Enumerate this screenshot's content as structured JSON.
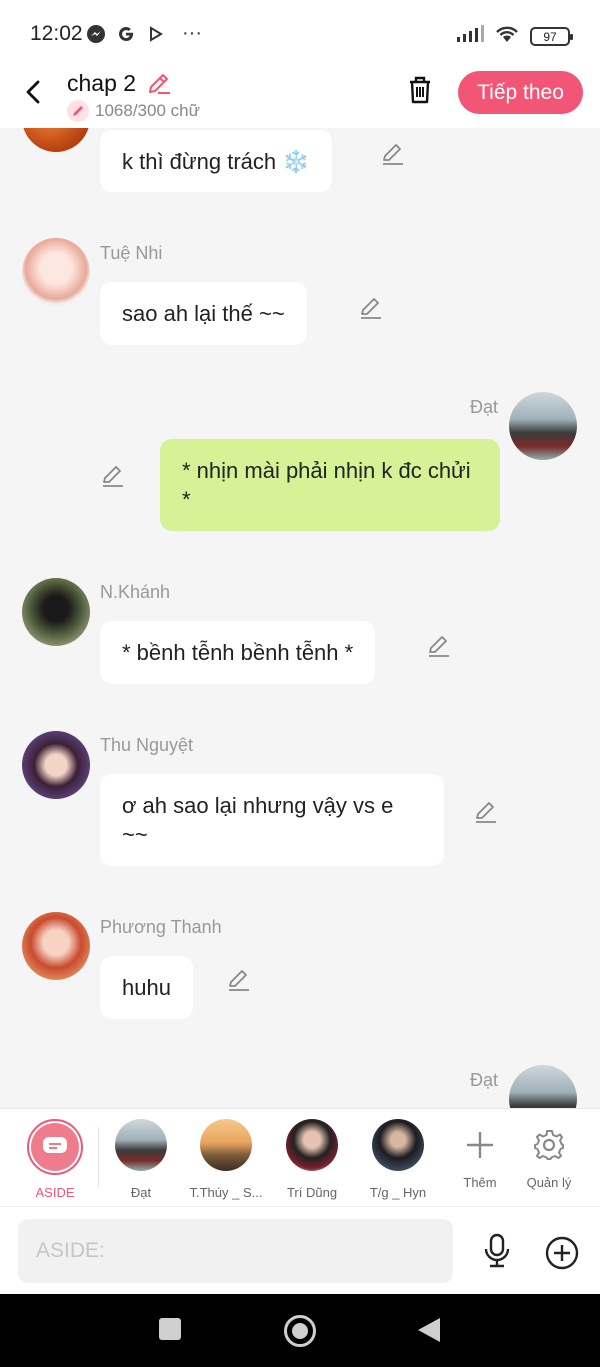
{
  "status": {
    "time": "12:02",
    "battery": "97",
    "more": "···"
  },
  "header": {
    "back_icon": "chevron-left-icon",
    "title": "chap 2",
    "word_count": "1068/300 chữ",
    "next_label": "Tiếp theo",
    "accent": "#f25576"
  },
  "messages": [
    {
      "sender": "",
      "text": "k thì đừng trách ❄️",
      "side": "left"
    },
    {
      "sender": "Tuệ Nhi",
      "text": "sao ah lại thế ~~",
      "side": "left"
    },
    {
      "sender": "Đạt",
      "text": "* nhịn mài phải nhịn k đc chửi *",
      "side": "right"
    },
    {
      "sender": "N.Khánh",
      "text": "* bềnh tễnh bềnh tễnh *",
      "side": "left"
    },
    {
      "sender": "Thu Nguyệt",
      "text": "ơ ah sao lại nhưng vậy vs e ~~",
      "side": "left"
    },
    {
      "sender": "Phương Thanh",
      "text": "huhu",
      "side": "left"
    },
    {
      "sender": "Đạt",
      "text": "",
      "side": "right"
    }
  ],
  "characters": [
    {
      "label": "ASIDE",
      "selected": true
    },
    {
      "label": "Đạt"
    },
    {
      "label": "T.Thúy _ S..."
    },
    {
      "label": "Trí Dũng"
    },
    {
      "label": "T/g _ Hyn"
    },
    {
      "label": "Thêm"
    },
    {
      "label": "Quản lý"
    }
  ],
  "input": {
    "placeholder": "ASIDE:"
  },
  "colors": {
    "bubble_me": "#d6f296",
    "bubble_other": "#ffffff",
    "background": "#f5f5f5"
  }
}
